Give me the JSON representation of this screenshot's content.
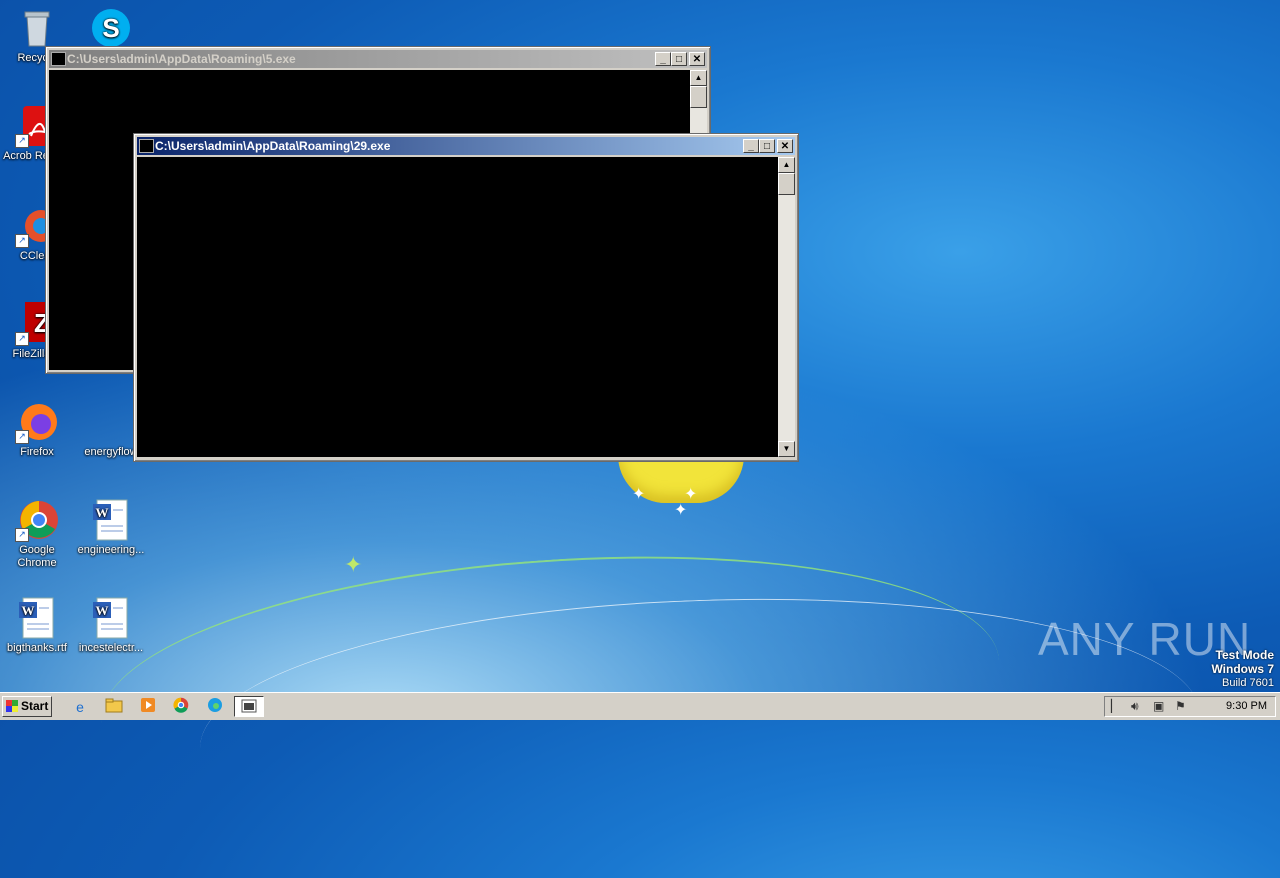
{
  "desktop": {
    "icons": [
      {
        "label": "Recycle"
      },
      {
        "label": "Acrob Reader"
      },
      {
        "label": "CClear"
      },
      {
        "label": "FileZilla C"
      },
      {
        "label": "Firefox"
      },
      {
        "label": "energyflow"
      },
      {
        "label": "Google Chrome"
      },
      {
        "label": "engineering..."
      },
      {
        "label": "bigthanks.rtf"
      },
      {
        "label": "incestelectr..."
      }
    ]
  },
  "windows": {
    "back": {
      "title": "C:\\Users\\admin\\AppData\\Roaming\\5.exe"
    },
    "front": {
      "title": "C:\\Users\\admin\\AppData\\Roaming\\29.exe"
    }
  },
  "taskbar": {
    "start_label": "Start",
    "clock": "9:30 PM"
  },
  "watermark": {
    "line1": "Test Mode",
    "line2": "Windows 7",
    "line3": "Build 7601",
    "brand": "ANY RUN"
  }
}
